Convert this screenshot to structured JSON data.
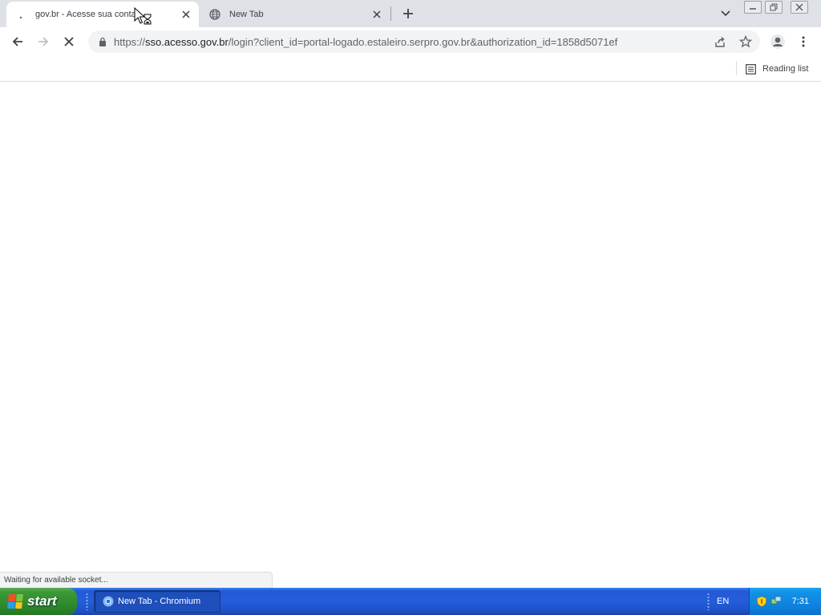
{
  "tabs": [
    {
      "title": "gov.br - Acesse sua conta",
      "active": true
    },
    {
      "title": "New Tab",
      "active": false
    }
  ],
  "toolbar": {
    "url_scheme": "https://",
    "url_host": "sso.acesso.gov.br",
    "url_path": "/login?client_id=portal-logado.estaleiro.serpro.gov.br&authorization_id=1858d5071ef"
  },
  "bookmarks": {
    "reading_list_label": "Reading list"
  },
  "status_bar": {
    "text": "Waiting for available socket..."
  },
  "taskbar": {
    "start_label": "start",
    "task_item_label": "New Tab - Chromium",
    "language": "EN",
    "clock": "7:31"
  },
  "colors": {
    "tabstrip": "#dee1e6",
    "omnibox": "#f1f3f4",
    "taskbar": "#245edb",
    "start": "#3c9a36",
    "tray": "#0f84e0"
  }
}
